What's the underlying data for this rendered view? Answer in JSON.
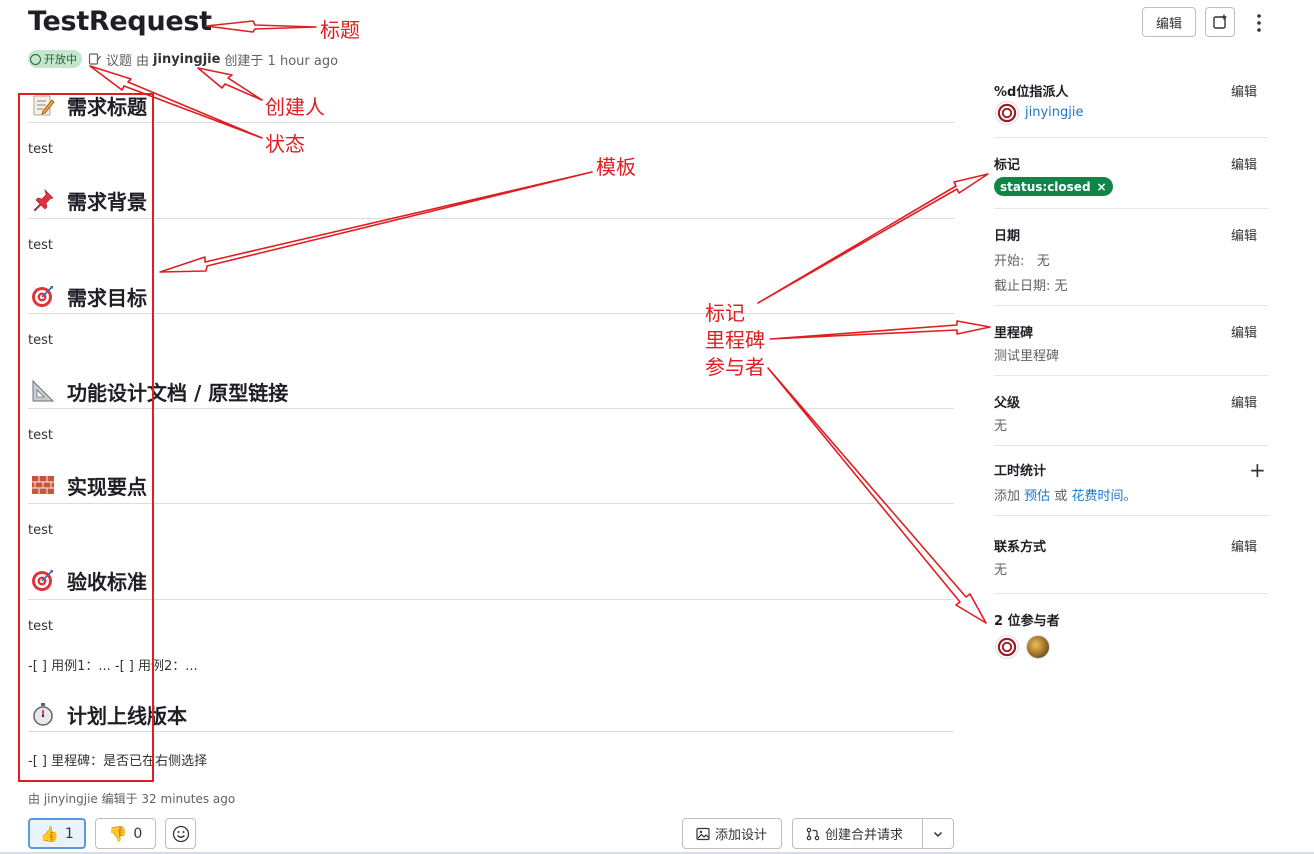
{
  "issue": {
    "title": "TestRequest",
    "status": "开放中",
    "type_label": "议题",
    "by": "由",
    "author": "jinyingjie",
    "created": "创建于 1 hour ago"
  },
  "header": {
    "edit_label": "编辑"
  },
  "sections": [
    {
      "icon": "memo-icon",
      "title": "需求标题",
      "body": "test"
    },
    {
      "icon": "pushpin-icon",
      "title": "需求背景",
      "body": "test"
    },
    {
      "icon": "dart-icon",
      "title": "需求目标",
      "body": "test"
    },
    {
      "icon": "triangle-ruler-icon",
      "title": "功能设计文档 / 原型链接",
      "body": "test"
    },
    {
      "icon": "brick-icon",
      "title": "实现要点",
      "body": "test"
    },
    {
      "icon": "dart-icon",
      "title": "验收标准",
      "body": "test",
      "extra": "-[ ] 用例1：... -[ ] 用例2：..."
    },
    {
      "icon": "stopwatch-icon",
      "title": "计划上线版本",
      "body": "-[ ] 里程碑：是否已在右侧选择"
    }
  ],
  "edited_note": "由 jinyingjie 编辑于 32 minutes ago",
  "reactions": {
    "thumbs_up": "1",
    "thumbs_down": "0"
  },
  "actions": {
    "add_design": "添加设计",
    "create_mr": "创建合并请求"
  },
  "sidebar": {
    "edit": "编辑",
    "assignee": {
      "title": "%d位指派人",
      "name": "jinyingjie"
    },
    "labels": {
      "title": "标记",
      "label": "status::closed",
      "label_display": "status:closed",
      "remove": "×"
    },
    "dates": {
      "title": "日期",
      "start": "开始:   无",
      "due": "截止日期: 无"
    },
    "milestone": {
      "title": "里程碑",
      "value": "测试里程碑"
    },
    "parent": {
      "title": "父级",
      "value": "无"
    },
    "time": {
      "title": "工时统计",
      "prefix": "添加",
      "estimate": "预估",
      "or": "或",
      "spent": "花费时间。",
      "plus": "+"
    },
    "contact": {
      "title": "联系方式",
      "value": "无"
    },
    "participants": {
      "title": "2 位参与者"
    }
  },
  "annotations": {
    "title": "标题",
    "creator": "创建人",
    "status": "状态",
    "template": "模板",
    "label": "标记",
    "milestone": "里程碑",
    "participants": "参与者"
  },
  "colors": {
    "annotation_red": "#e01e22",
    "status_green": "#108548",
    "link_blue": "#1f75cb"
  }
}
